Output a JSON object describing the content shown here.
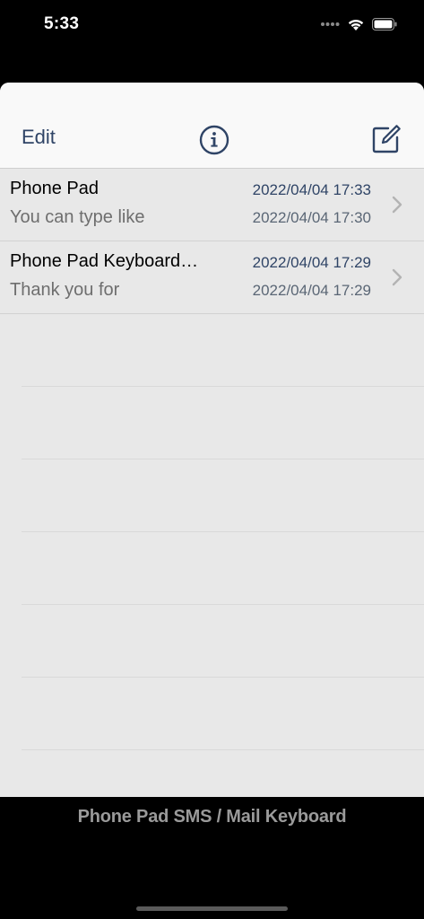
{
  "status_bar": {
    "time": "5:33",
    "signal_icon": "cellular-signal-dots-icon",
    "wifi_icon": "wifi-icon",
    "battery_icon": "battery-full-icon"
  },
  "navbar": {
    "edit_label": "Edit",
    "info_icon": "info-circle-icon",
    "compose_icon": "compose-square-pencil-icon",
    "accent_color": "#2f4466"
  },
  "messages": [
    {
      "title": "Phone Pad",
      "preview": "You can type like",
      "date_main": "2022/04/04 17:33",
      "date_sub": "2022/04/04 17:30"
    },
    {
      "title": "Phone Pad Keyboard…",
      "preview": "Thank you for",
      "date_main": "2022/04/04 17:29",
      "date_sub": "2022/04/04 17:29"
    }
  ],
  "banner": {
    "text": "Phone Pad SMS / Mail Keyboard"
  }
}
